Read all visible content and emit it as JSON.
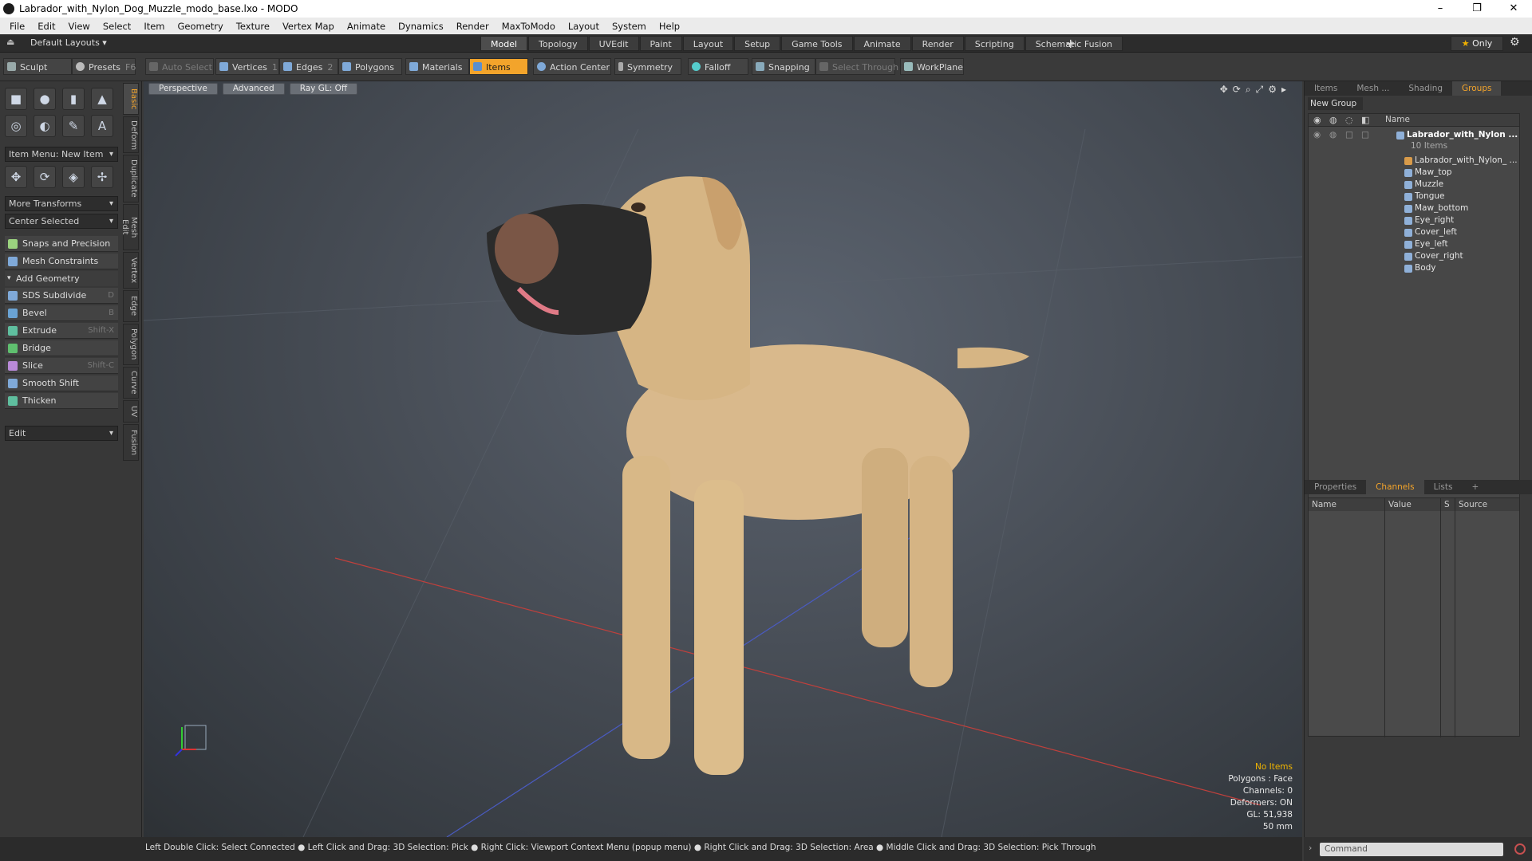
{
  "title_bar": {
    "title": "Labrador_with_Nylon_Dog_Muzzle_modo_base.lxo - MODO",
    "minimize": "–",
    "restore": "❐",
    "close": "✕"
  },
  "menu": [
    "File",
    "Edit",
    "View",
    "Select",
    "Item",
    "Geometry",
    "Texture",
    "Vertex Map",
    "Animate",
    "Dynamics",
    "Render",
    "MaxToModo",
    "Layout",
    "System",
    "Help"
  ],
  "layout_bar": {
    "layouts_label": "Default Layouts ▾",
    "tabs": [
      "Model",
      "Topology",
      "UVEdit",
      "Paint",
      "Layout",
      "Setup",
      "Game Tools",
      "Animate",
      "Render",
      "Scripting",
      "Schematic Fusion"
    ],
    "active_tab": "Model",
    "add": "+",
    "only_label": "Only"
  },
  "toolbar": {
    "sculpt": "Sculpt",
    "presets": "Presets",
    "presets_key": "F6",
    "auto_select": "Auto Select",
    "vertices": "Vertices",
    "vertices_count": "1",
    "edges": "Edges",
    "edges_count": "2",
    "polygons": "Polygons",
    "materials": "Materials",
    "items": "Items",
    "action_center": "Action Center",
    "symmetry": "Symmetry",
    "falloff": "Falloff",
    "snapping": "Snapping",
    "select_through": "Select Through",
    "workplane": "WorkPlane"
  },
  "left_panel": {
    "item_menu": "Item Menu: New Item",
    "more_transforms": "More Transforms",
    "center_selected": "Center Selected",
    "snaps": "Snaps and Precision",
    "mesh_constraints": "Mesh Constraints",
    "add_geometry": "Add Geometry",
    "tools": [
      {
        "label": "SDS Subdivide",
        "key": "D"
      },
      {
        "label": "Bevel",
        "key": "B"
      },
      {
        "label": "Extrude",
        "key": "Shift-X"
      },
      {
        "label": "Bridge",
        "key": ""
      },
      {
        "label": "Slice",
        "key": "Shift-C"
      },
      {
        "label": "Smooth Shift",
        "key": ""
      },
      {
        "label": "Thicken",
        "key": ""
      }
    ],
    "edit": "Edit",
    "vtabs": [
      "Basic",
      "Deform",
      "Duplicate",
      "Mesh Edit",
      "Vertex",
      "Edge",
      "Polygon",
      "Curve",
      "UV",
      "Fusion"
    ]
  },
  "viewport": {
    "buttons": [
      "Perspective",
      "Advanced",
      "Ray GL: Off"
    ],
    "info": {
      "no_items": "No Items",
      "polygons": "Polygons : Face",
      "channels": "Channels: 0",
      "deformers": "Deformers: ON",
      "gl": "GL: 51,938",
      "focal": "50 mm"
    }
  },
  "right_panel": {
    "tabs": [
      "Items",
      "Mesh ...",
      "Shading",
      "Groups"
    ],
    "active_tab": "Groups",
    "new_group": "New Group",
    "name_header": "Name",
    "root": "Labrador_with_Nylon ...",
    "root_sub": "10 Items",
    "items": [
      "Labrador_with_Nylon_ ...",
      "Maw_top",
      "Muzzle",
      "Tongue",
      "Maw_bottom",
      "Eye_right",
      "Cover_left",
      "Eye_left",
      "Cover_right",
      "Body"
    ],
    "bottom_tabs": [
      "Properties",
      "Channels",
      "Lists",
      "+"
    ],
    "bottom_active": "Channels",
    "channel_headers": [
      "Name",
      "Value",
      "S",
      "Source"
    ],
    "command_placeholder": "Command"
  },
  "status_bar": "Left Double Click: Select Connected ● Left Click and Drag: 3D Selection: Pick ● Right Click: Viewport Context Menu (popup menu) ● Right Click and Drag: 3D Selection: Area ● Middle Click and Drag: 3D Selection: Pick Through",
  "colors": {
    "accent": "#f3a42b",
    "warning_text": "#f0b400"
  }
}
